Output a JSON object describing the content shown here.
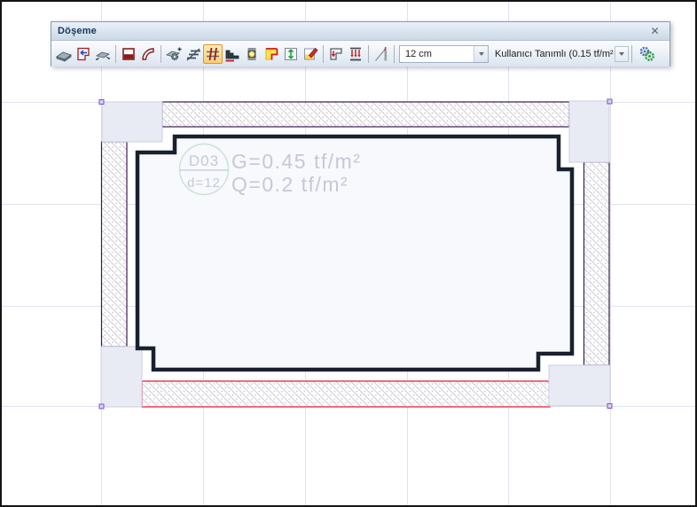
{
  "window": {
    "title": "Döşeme",
    "close_glyph": "✕"
  },
  "toolbar": {
    "thickness_value": "12 cm",
    "load_value": "Kullanıcı Tanımlı (0.15 tf/m²",
    "icon_names": [
      "slab",
      "slab-by-outline",
      "slab-mirror",
      "panel-region",
      "curved-edge",
      "slab-properties",
      "hatch-lines",
      "axes-grid",
      "stepped-slab",
      "slab-light",
      "corner-region",
      "vertical-extent",
      "modify-region",
      "drop-panel",
      "slab-loads",
      "inclined-slab",
      "settings-gears"
    ],
    "active_tool": "axes-grid"
  },
  "drawing": {
    "slab_id": "D03",
    "slab_thickness": "d=12",
    "dead_load": "G=0.45 tf/m²",
    "live_load": "Q=0.2 tf/m²"
  },
  "colors": {
    "selection_red": "#f04a5e",
    "wall_outline": "#371c52",
    "slab_outline": "#19202e",
    "marker_purple": "#7b52c9",
    "active_tool_highlight": "#fcd47e",
    "label_text": "#c6c8da",
    "label_circle": "#cbe0d2"
  }
}
